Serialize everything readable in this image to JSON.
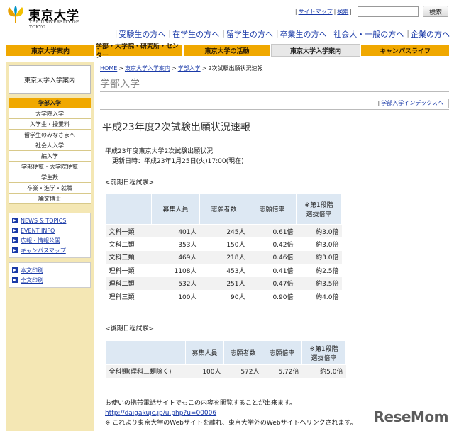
{
  "header": {
    "univ_name_ja": "東京大学",
    "univ_name_en": "THE UNIVERSITY OF TOKYO",
    "util_links": [
      "サイトマップ",
      "検索"
    ],
    "search_value": "",
    "search_button": "検索"
  },
  "audience_links": [
    "受験生の方へ",
    "在学生の方へ",
    "留学生の方へ",
    "卒業生の方へ",
    "社会人・一般の方へ",
    "企業の方へ"
  ],
  "nav_tabs": [
    {
      "label": "東京大学案内"
    },
    {
      "label": "学部・大学院・研究所・センター"
    },
    {
      "label": "東京大学の活動"
    },
    {
      "label": "東京大学入学案内"
    },
    {
      "label": "キャンパスライフ"
    }
  ],
  "sidebar": {
    "title": "東京大学入学案内",
    "menu": [
      "学部入学",
      "大学院入学",
      "入学金・授業料",
      "留学生のみなさまへ",
      "社会人入学",
      "編入学",
      "学部便覧・大学院便覧",
      "学生数",
      "卒業・進学・就職",
      "論文博士"
    ],
    "links": [
      "NEWS & TOPICS",
      "EVENT INFO",
      "広報・情報公開",
      "キャンパスマップ"
    ],
    "print_links": [
      "本文印刷",
      "全文印刷"
    ]
  },
  "breadcrumb": [
    "HOME",
    "東京大学入学案内",
    "学部入学",
    "2次試験出願状況速報"
  ],
  "page_heading": "学部入学",
  "index_link": "学部入学インデックスへ",
  "main_title": "平成23年度2次試験出願状況速報",
  "status": {
    "line1": "平成23年度東京大学2次試験出願状況",
    "line2": "更新日時：平成23年1月25日(火)17:00(現在)"
  },
  "first_round": {
    "label": "<前期日程試験>",
    "headers": [
      "",
      "募集人員",
      "志願者数",
      "志願倍率",
      "※第1段階\n選抜倍率"
    ],
    "rows": [
      [
        "文科一類",
        "401人",
        "245人",
        "0.61倍",
        "約3.0倍"
      ],
      [
        "文科二類",
        "353人",
        "150人",
        "0.42倍",
        "約3.0倍"
      ],
      [
        "文科三類",
        "469人",
        "218人",
        "0.46倍",
        "約3.0倍"
      ],
      [
        "理科一類",
        "1108人",
        "453人",
        "0.41倍",
        "約2.5倍"
      ],
      [
        "理科二類",
        "532人",
        "251人",
        "0.47倍",
        "約3.5倍"
      ],
      [
        "理科三類",
        "100人",
        "90人",
        "0.90倍",
        "約4.0倍"
      ]
    ]
  },
  "second_round": {
    "label": "<後期日程試験>",
    "headers": [
      "",
      "募集人員",
      "志願者数",
      "志願倍率",
      "※第1段階\n選抜倍率"
    ],
    "rows": [
      [
        "全科類(理科三類除く)",
        "100人",
        "572人",
        "5.72倍",
        "約5.0倍"
      ]
    ]
  },
  "notes": {
    "line1": "お使いの携帯電話サイトでもこの内容を閲覧することが出来ます。",
    "url": "http://daigakujc.jp/u.php?u=00006",
    "line3": "※ これより東京大学のWebサイトを離れ、東京大学外のWebサイトへリンクされます。"
  },
  "watermark": "ReseMom",
  "colors": {
    "nav": "#f0a800",
    "sidebar_bg": "#f4e7b4",
    "table_header": "#dde8f3",
    "link": "#1a3aa8"
  }
}
